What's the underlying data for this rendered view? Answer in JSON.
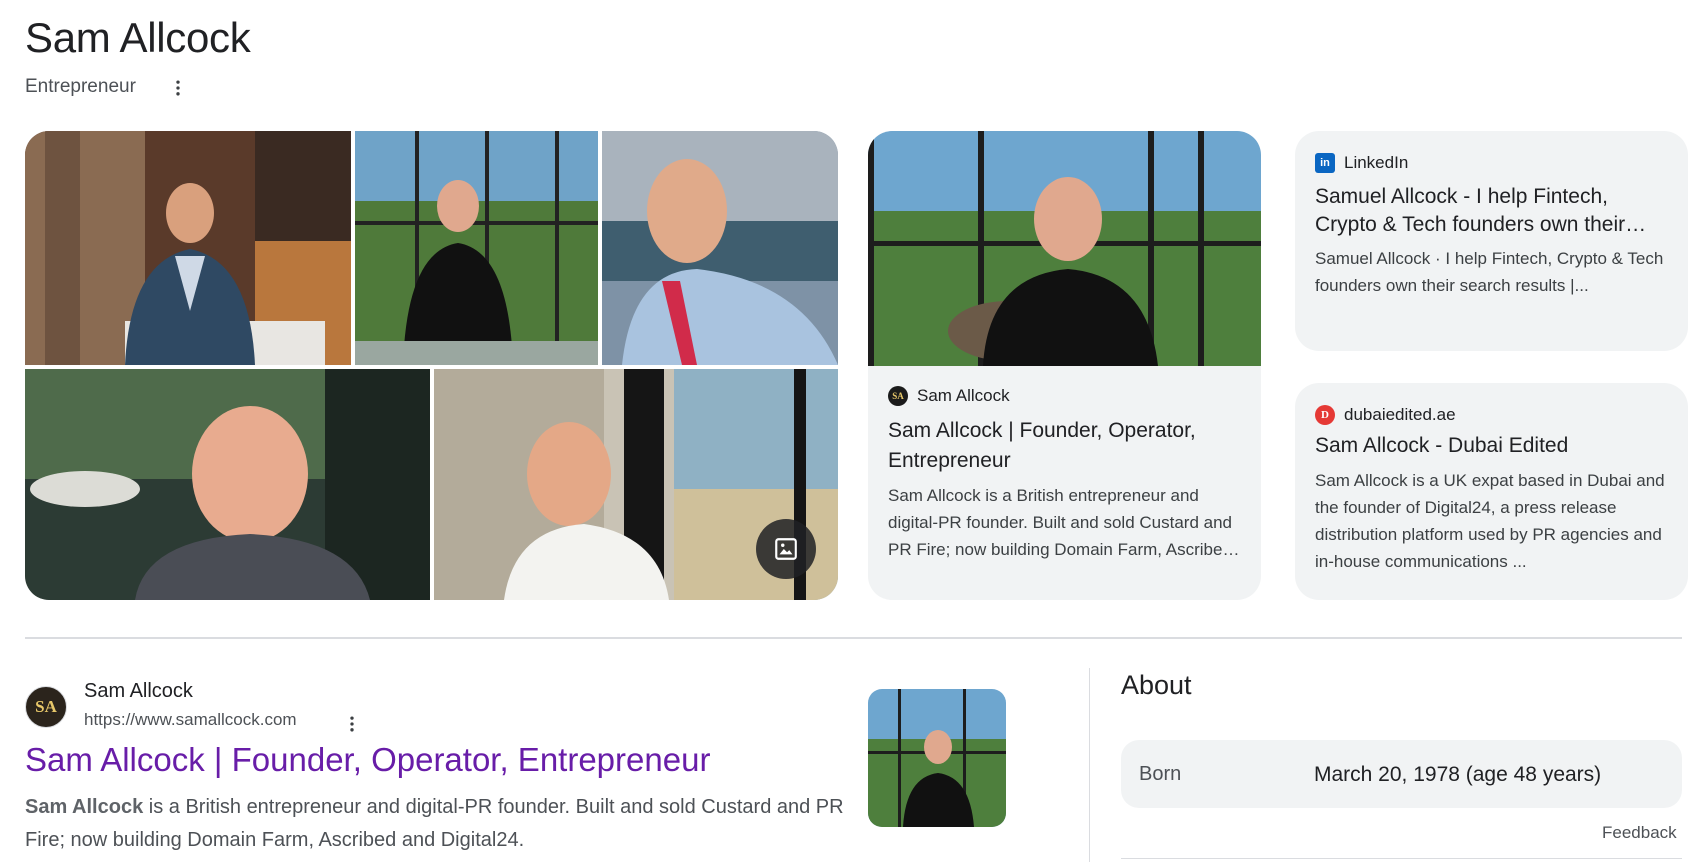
{
  "entity": {
    "name": "Sam Allcock",
    "type": "Entrepreneur"
  },
  "gallery": {
    "photos": [
      "person-photo-cafe",
      "person-photo-window",
      "person-photo-harbour-selfie",
      "person-photo-terrace",
      "person-photo-restaurant"
    ]
  },
  "cards": [
    {
      "source": "Sam Allcock",
      "favicon": "SA",
      "title": "Sam Allcock | Founder, Operator, Entrepreneur",
      "description": "Sam Allcock is a British entrepreneur and digital-PR founder. Built and sold Custard and PR Fire; now building Domain Farm, Ascribed and Digital24."
    },
    {
      "source": "LinkedIn",
      "favicon": "in",
      "title": "Samuel Allcock - I help Fintech, Crypto & Tech founders own their search results",
      "description": "Samuel Allcock · I help Fintech, Crypto & Tech founders own their search results |..."
    },
    {
      "source": "dubaiedited.ae",
      "favicon": "D",
      "title": "Sam Allcock - Dubai Edited",
      "description": "Sam Allcock is a UK expat based in Dubai and the founder of Digital24, a press release distribution platform used by PR agencies and in-house communications ..."
    }
  ],
  "result": {
    "site_name": "Sam Allcock",
    "avatar": "SA",
    "url": "https://www.samallcock.com",
    "title": "Sam Allcock | Founder, Operator, Entrepreneur",
    "snippet_bold": "Sam Allcock",
    "snippet_rest": " is a British entrepreneur and digital-PR founder. Built and sold Custard and PR Fire; now building Domain Farm, Ascribed and Digital24."
  },
  "about": {
    "heading": "About",
    "born_label": "Born",
    "born_value": "March 20, 1978 (age 48 years)",
    "feedback": "Feedback"
  },
  "colors": {
    "link_visited": "#681da8",
    "card_bg": "#f1f3f4",
    "linkedin": "#0a66c2",
    "dubai": "#e53935"
  }
}
